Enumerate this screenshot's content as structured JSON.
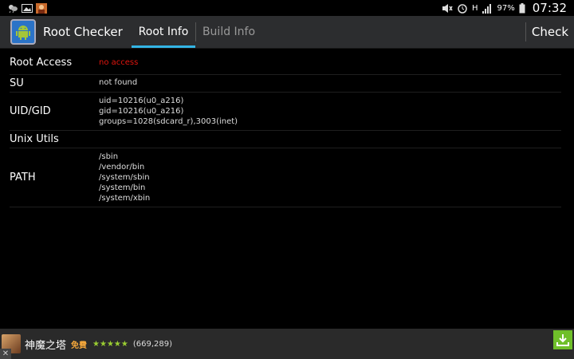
{
  "status_bar": {
    "battery_percent": "97%",
    "time": "07:32",
    "network_type": "H",
    "icons_left": [
      "weather-icon",
      "image-icon",
      "game-notification-icon"
    ],
    "icons_right": [
      "mute-icon",
      "alarm-icon",
      "network-h-icon",
      "signal-icon",
      "battery-icon"
    ]
  },
  "action_bar": {
    "app_title": "Root Checker",
    "tabs": [
      {
        "label": "Root Info",
        "selected": true
      },
      {
        "label": "Build Info",
        "selected": false
      }
    ],
    "check_label": "Check"
  },
  "rows": [
    {
      "label": "Root Access",
      "values": [
        "no access"
      ],
      "color": "#e1150e"
    },
    {
      "label": "SU",
      "values": [
        "not found"
      ]
    },
    {
      "label": "UID/GID",
      "values": [
        "uid=10216(u0_a216)",
        "gid=10216(u0_a216)",
        "groups=1028(sdcard_r),3003(inet)"
      ]
    },
    {
      "label": "Unix Utils",
      "values": []
    },
    {
      "label": "PATH",
      "values": [
        "/sbin",
        "/vendor/bin",
        "/system/sbin",
        "/system/bin",
        "/system/xbin"
      ]
    }
  ],
  "ad": {
    "title": "神魔之塔",
    "price": "免費",
    "rating": "★★★★★",
    "review_count": "(669,289)",
    "close": "✕"
  },
  "colors": {
    "accent": "#33b5e5",
    "error": "#e1150e",
    "action_bar": "#2c2d2f",
    "download": "#6fbf2a"
  }
}
